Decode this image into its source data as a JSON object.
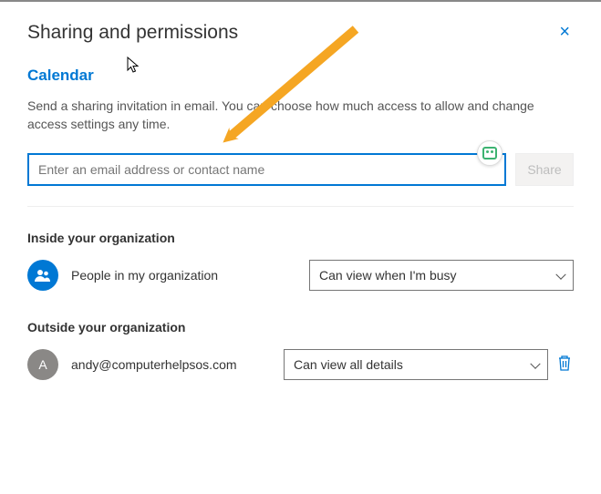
{
  "header": {
    "title": "Sharing and permissions",
    "close_label": "×"
  },
  "calendar": {
    "subtitle": "Calendar",
    "description": "Send a sharing invitation in email. You can choose how much access to allow and change access settings any time.",
    "input_placeholder": "Enter an email address or contact name",
    "share_button": "Share"
  },
  "sections": {
    "inside": {
      "title": "Inside your organization",
      "row": {
        "label": "People in my organization",
        "select_value": "Can view when I'm busy"
      }
    },
    "outside": {
      "title": "Outside your organization",
      "row": {
        "avatar_initial": "A",
        "label": "andy@computerhelpsos.com",
        "select_value": "Can view all details"
      }
    }
  }
}
